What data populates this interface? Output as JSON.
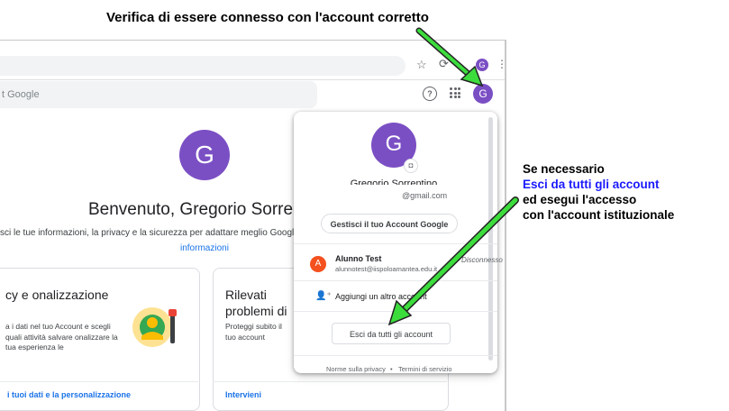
{
  "annotations": {
    "top_caption": "Verifica di essere connesso con l'account corretto",
    "right_note": {
      "line1": "Se necessario",
      "line2": "Esci da tutti gli account",
      "line3": "ed esegui l'accesso",
      "line4": "con l'account istituzionale"
    },
    "arrow_color": "#3ddc3d"
  },
  "browser": {
    "avatar_letter": "G"
  },
  "header": {
    "search_placeholder": "t Google",
    "avatar_letter": "G"
  },
  "main": {
    "avatar_letter": "G",
    "welcome": "Benvenuto, Gregorio Sorrentino",
    "subtitle": "sci le tue informazioni, la privacy e la sicurezza per adattare meglio Google alle tue esigenze.",
    "subtitle_link": "informazioni",
    "cards": [
      {
        "title": "cy e onalizzazione",
        "description": "a i dati nel tuo Account e scegli quali attività salvare onalizzare la tua esperienza le",
        "link": "i tuoi dati e la personalizzazione"
      },
      {
        "title": "Rilevati problemi di sicurezza critici",
        "description": "Proteggi subito il tuo account risolvendo questi problemi",
        "link": "Intervieni"
      }
    ]
  },
  "popup": {
    "avatar_letter": "G",
    "name": "Gregorio Sorrentino",
    "email": "@gmail.com",
    "manage_button": "Gestisci il tuo Account Google",
    "other_account": {
      "avatar_letter": "A",
      "name": "Alunno Test",
      "email": "alunnotest@iispoloamantea.edu.it",
      "status": "Disconnesso"
    },
    "add_account": "Aggiungi un altro account",
    "signout_button": "Esci da tutti gli account",
    "privacy": "Norme sulla privacy",
    "separator": "•",
    "terms": "Termini di servizio"
  }
}
